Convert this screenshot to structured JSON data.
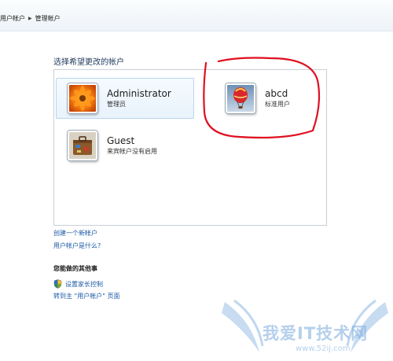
{
  "breadcrumb": {
    "items": [
      "用户帐户",
      "管理帐户"
    ]
  },
  "page": {
    "heading": "选择希望更改的帐户"
  },
  "accounts": [
    {
      "name": "Administrator",
      "type": "管理员",
      "avatar": "flower-icon",
      "selected": true
    },
    {
      "name": "abcd",
      "type": "标准用户",
      "avatar": "hot-air-balloon-icon",
      "selected": false
    },
    {
      "name": "Guest",
      "type": "来宾帐户没有启用",
      "avatar": "suitcase-icon",
      "selected": false
    }
  ],
  "links": {
    "create_account": "创建一个新帐户",
    "what_is_account": "用户帐户是什么?"
  },
  "other_tasks": {
    "title": "您能做的其他事",
    "parental_controls": "设置家长控制",
    "goto_main": "转到主 \"用户帐户\" 页面"
  },
  "watermark": {
    "text": "我爱IT技术网",
    "url": "www.52ij.com"
  },
  "colors": {
    "link": "#1a5aa6",
    "heading": "#1e395b",
    "annotation": "#e01020"
  }
}
